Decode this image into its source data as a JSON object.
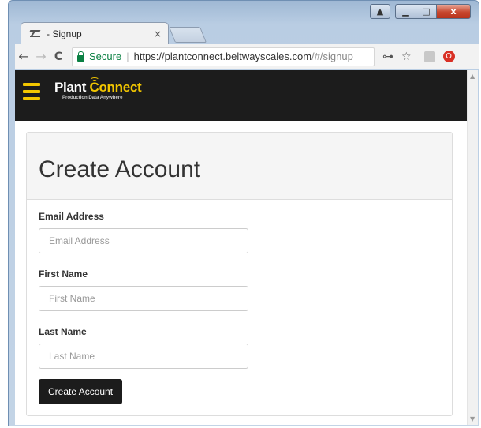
{
  "browser": {
    "tab_title": "- Signup",
    "tab_close": "×",
    "secure_label": "Secure",
    "url_host": "https://plantconnect.beltwayscales.com",
    "url_path": "/#/signup",
    "window_controls": {
      "user": "▲",
      "minimize": "▁",
      "maximize": "□",
      "close": "x"
    }
  },
  "navbar": {
    "brand_plant": "Plant",
    "brand_connect": "Connect",
    "tagline": "Production Data Anywhere",
    "accent_color": "#f2c600"
  },
  "form": {
    "title": "Create Account",
    "email_label": "Email Address",
    "email_placeholder": "Email Address",
    "first_name_label": "First Name",
    "first_name_placeholder": "First Name",
    "last_name_label": "Last Name",
    "last_name_placeholder": "Last Name",
    "submit_label": "Create Account"
  },
  "icons": {
    "back": "←",
    "forward": "→",
    "reload": "C",
    "key": "⊶",
    "star": "☆",
    "ext": "O"
  }
}
